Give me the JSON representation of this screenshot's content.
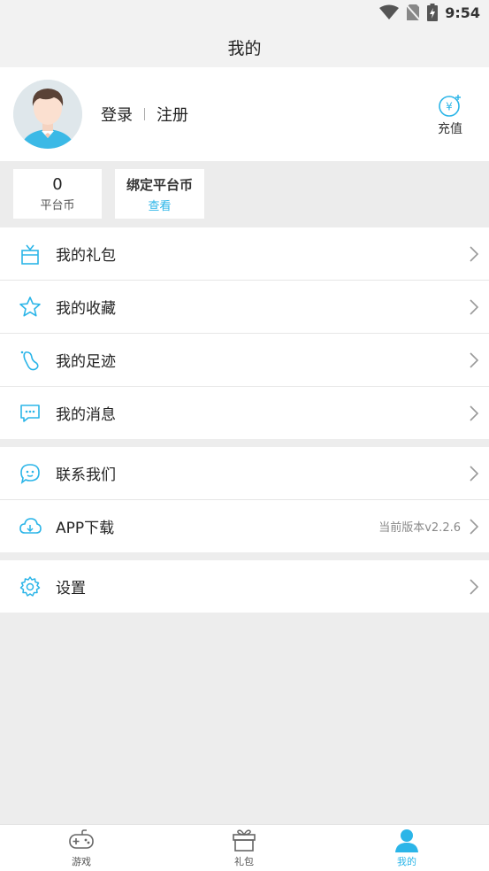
{
  "status_bar": {
    "time": "9:54"
  },
  "header": {
    "title": "我的"
  },
  "profile": {
    "login_label": "登录",
    "register_label": "注册",
    "recharge_label": "充值"
  },
  "coins": {
    "platform": {
      "value": "0",
      "label": "平台币"
    },
    "bound": {
      "title": "绑定平台币",
      "link": "查看"
    }
  },
  "menu": {
    "group1": [
      {
        "label": "我的礼包",
        "icon": "gift-box-icon"
      },
      {
        "label": "我的收藏",
        "icon": "star-icon"
      },
      {
        "label": "我的足迹",
        "icon": "footprint-icon"
      },
      {
        "label": "我的消息",
        "icon": "message-icon"
      }
    ],
    "group2": [
      {
        "label": "联系我们",
        "icon": "chat-bubble-icon"
      },
      {
        "label": "APP下载",
        "icon": "cloud-download-icon",
        "extra": "当前版本v2.2.6"
      }
    ],
    "group3": [
      {
        "label": "设置",
        "icon": "gear-icon"
      }
    ]
  },
  "tabbar": [
    {
      "label": "游戏",
      "icon": "gamepad-icon",
      "active": false
    },
    {
      "label": "礼包",
      "icon": "gift-icon",
      "active": false
    },
    {
      "label": "我的",
      "icon": "user-icon",
      "active": true
    }
  ],
  "colors": {
    "accent": "#2bb5e8",
    "background": "#ededed",
    "text": "#222222"
  }
}
